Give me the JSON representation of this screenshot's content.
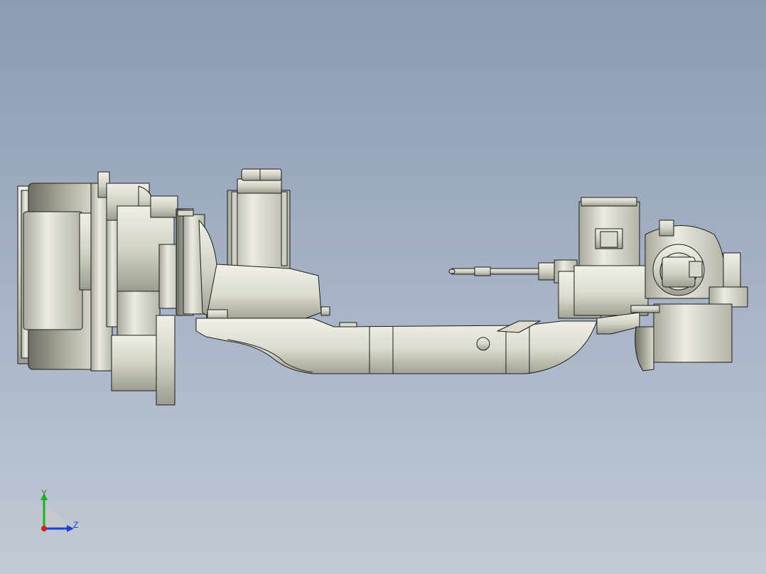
{
  "triad": {
    "y_label": "Y",
    "z_label": "Z",
    "y_color": "#1db01d",
    "z_color": "#1f3fd6",
    "x_color": "#d61f1f"
  },
  "colors": {
    "background_top": "#8a9bb3",
    "background_bottom": "#c2c9d6",
    "part_light": "#e8e7de",
    "part_mid": "#c9c8bc",
    "part_dark": "#8f8e82",
    "edge": "#1c1c1c"
  }
}
